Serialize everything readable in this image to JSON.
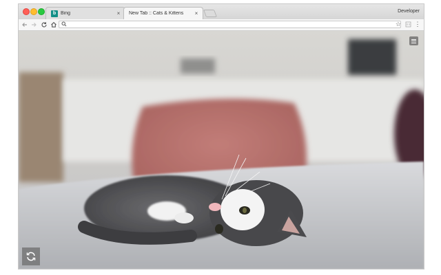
{
  "window": {
    "profile_name": "Developer"
  },
  "tabs": [
    {
      "favicon": "b",
      "title": "Bing",
      "close": "×"
    },
    {
      "title": "New Tab :: Cats & Kittens",
      "close": "×"
    }
  ],
  "toolbar": {
    "back_icon": "arrow-left-icon",
    "forward_icon": "arrow-right-icon",
    "reload_icon": "reload-icon",
    "home_icon": "home-icon",
    "address_value": "",
    "bookmark_icon": "star-icon",
    "extension_icon": "extension-icon",
    "menu_icon": "kebab-menu-icon"
  },
  "content": {
    "photo_subject": "cat-photo",
    "menu_icon": "hamburger-icon",
    "refresh_icon": "refresh-icon"
  },
  "colors": {
    "favicon_bg": "#138f87",
    "traffic_close": "#ff5f57",
    "traffic_min": "#ffbd2e",
    "traffic_max": "#28c940"
  }
}
